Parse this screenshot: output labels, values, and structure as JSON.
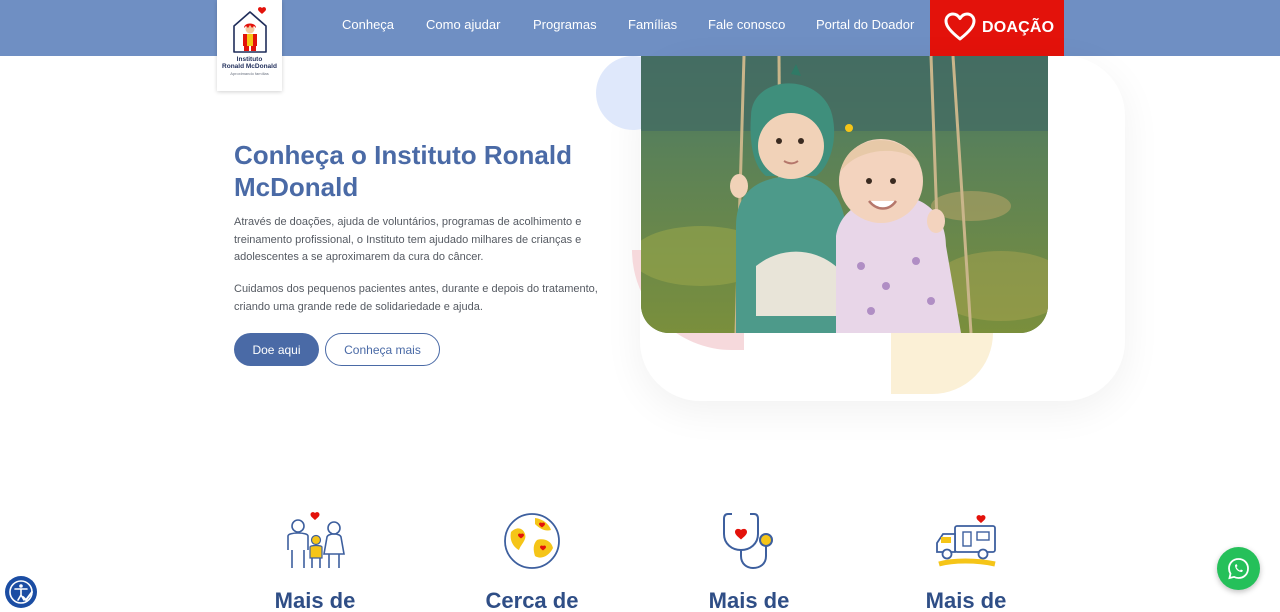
{
  "logo": {
    "line1": "Instituto",
    "line2": "Ronald McDonald",
    "line3": "Aproximando famílias"
  },
  "nav": {
    "items": [
      {
        "label": "Conheça"
      },
      {
        "label": "Como ajudar"
      },
      {
        "label": "Programas"
      },
      {
        "label": "Famílias"
      },
      {
        "label": "Fale conosco"
      },
      {
        "label": "Portal do Doador"
      }
    ],
    "donate_label": "DOAÇÃO"
  },
  "hero": {
    "title": "Conheça o Instituto Ronald McDonald",
    "paragraph1": "Através de doações, ajuda de voluntários, programas de acolhimento e treinamento profissional, o Instituto tem ajudado milhares de crianças e adolescentes a se aproximarem da cura do câncer.",
    "paragraph2": "Cuidamos dos pequenos pacientes antes, durante e depois do tratamento, criando uma grande rede de solidariedade e ajuda.",
    "primary_button": "Doe aqui",
    "secondary_button": "Conheça mais"
  },
  "stats": [
    {
      "icon": "family-heart-icon",
      "label": "Mais de"
    },
    {
      "icon": "globe-hearts-icon",
      "label": "Cerca de"
    },
    {
      "icon": "stethoscope-heart-icon",
      "label": "Mais de"
    },
    {
      "icon": "truck-heart-icon",
      "label": "Mais de"
    }
  ],
  "colors": {
    "navbar": "#6f8fc3",
    "donate": "#e3120b",
    "primary": "#4a6aa6",
    "stat_text": "#2f4e86",
    "whatsapp": "#25c05a",
    "accessibility": "#1b4da3"
  }
}
